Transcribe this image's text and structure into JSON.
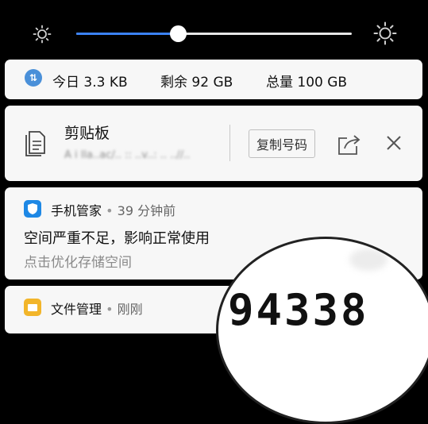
{
  "storage": {
    "today": "今日 3.3 KB",
    "remaining": "剩余 92 GB",
    "total": "总量 100 GB"
  },
  "clipboard": {
    "title": "剪贴板",
    "preview": "A i lla..ac/.. :: ..v..:  ..  ..//..",
    "copy_button": "复制号码"
  },
  "notification1": {
    "app": "手机管家",
    "separator": "•",
    "time": "39 分钟前",
    "title": "空间严重不足，影响正常使用",
    "subtitle": "点击优化存储空间"
  },
  "notification2": {
    "app": "文件管理",
    "separator": "•",
    "time": "刚刚"
  },
  "watermark": {
    "number": "94338"
  },
  "brightness": {
    "level": 0.37
  },
  "colors": {
    "accent": "#3b82f6",
    "app1_icon": "#1e88e5",
    "app2_icon": "#f2b52a"
  }
}
